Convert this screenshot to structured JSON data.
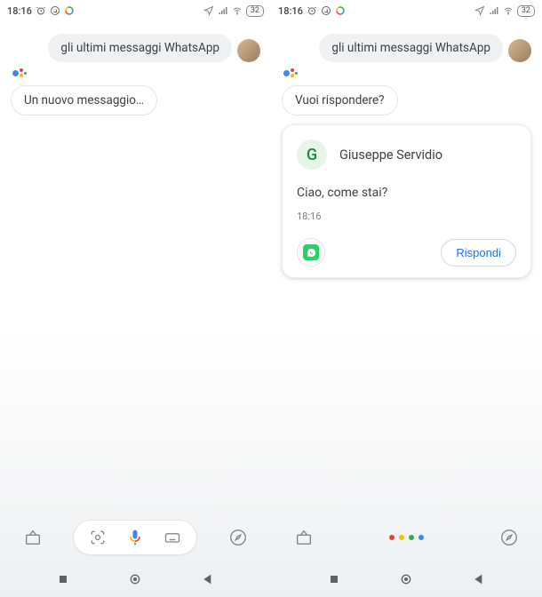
{
  "left": {
    "status": {
      "time": "18:16",
      "battery": "32"
    },
    "user_query": "gli ultimi messaggi WhatsApp",
    "assistant_reply": "Un nuovo messaggio…"
  },
  "right": {
    "status": {
      "time": "18:16",
      "battery": "32"
    },
    "user_query": "gli ultimi messaggi WhatsApp",
    "assistant_reply": "Vuoi rispondere?",
    "card": {
      "contact_initial": "G",
      "contact_name": "Giuseppe Servidio",
      "message_text": "Ciao, come stai?",
      "message_time": "18:16",
      "reply_label": "Rispondi"
    }
  }
}
